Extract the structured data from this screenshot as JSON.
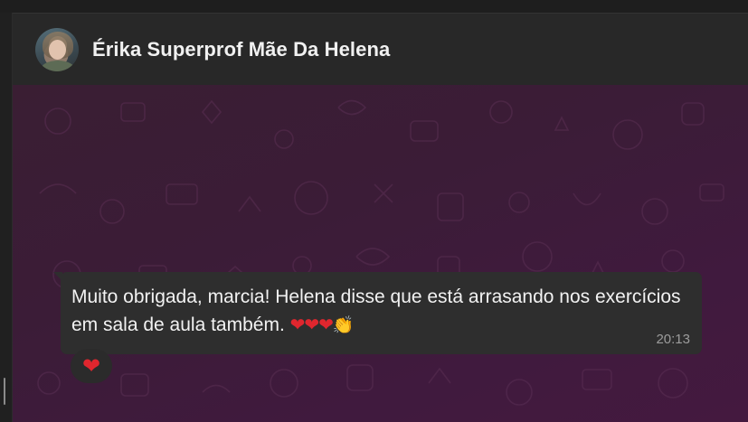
{
  "header": {
    "contact_name": "Érika Superprof Mãe Da Helena",
    "avatar_icon": "contact-avatar"
  },
  "message": {
    "text": "Muito obrigada, marcia! Helena disse que está arrasando nos exercícios em sala de aula também.",
    "emojis": "❤❤❤",
    "clap": "👏",
    "time": "20:13",
    "reaction": "❤"
  },
  "colors": {
    "header_bg": "#282828",
    "chat_bg": "#3b1c37",
    "bubble_bg": "#2e2e2e",
    "heart": "#e0262e"
  }
}
